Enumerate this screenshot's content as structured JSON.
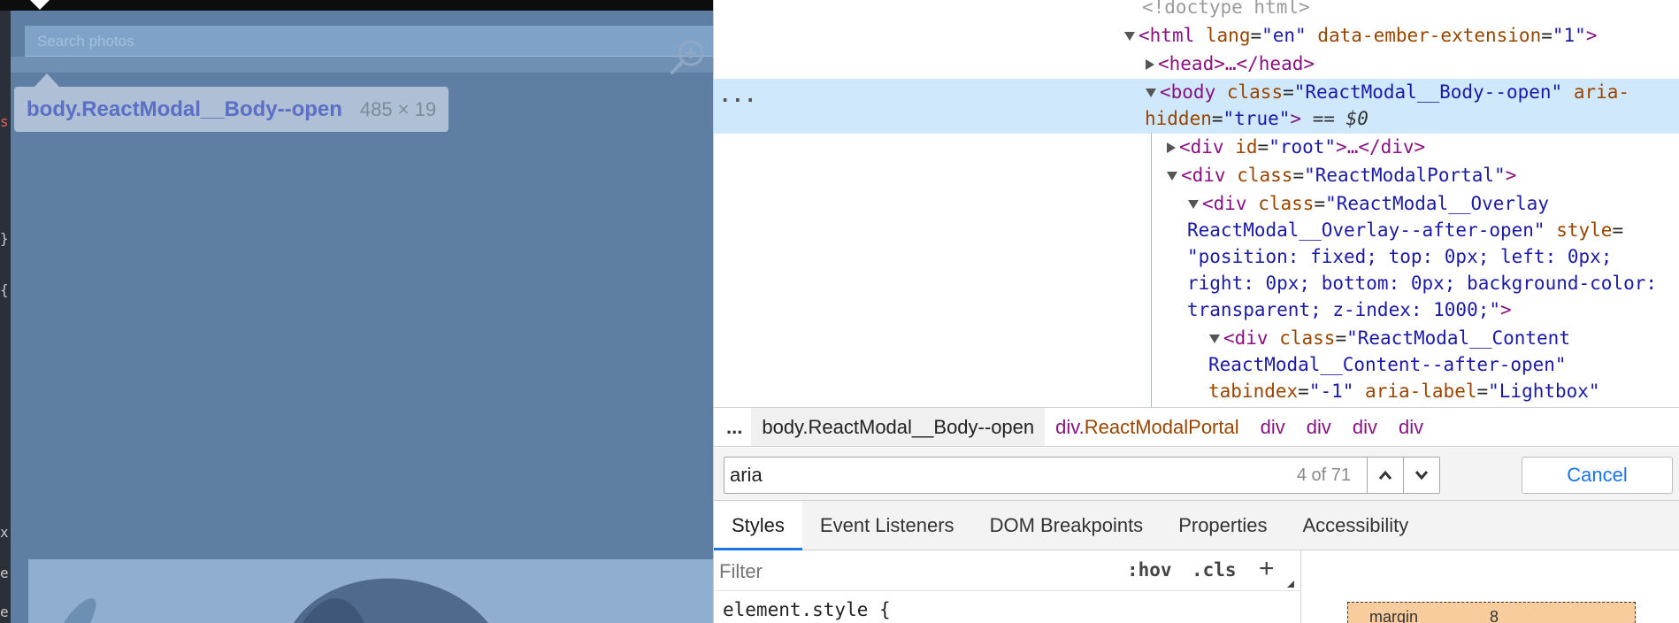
{
  "page": {
    "search_placeholder": "Search photos",
    "strip_chars": [
      "s",
      "}",
      "{",
      "x",
      "e",
      "e"
    ],
    "tooltip": {
      "element_name": "body.ReactModal__Body--open",
      "size": "485 × 19"
    }
  },
  "dom_tree": {
    "doctype": "<!doctype html>",
    "html_tag": "html",
    "html_lang_attr": "lang",
    "html_lang_val": "\"en\"",
    "html_ext_attr": "data-ember-extension",
    "html_ext_val": "\"1\"",
    "head_text": "<head>…</head>",
    "ellipsis": "...",
    "body_tag": "<body",
    "body_class_attr": "class",
    "body_class_val": "\"ReactModal__Body--open\"",
    "body_aria_attr_1": "aria-",
    "body_aria_attr_2": "hidden",
    "body_aria_val": "\"true\"",
    "body_close": ">",
    "body_eq": "== $0",
    "root_tag": "<div",
    "root_attr": "id",
    "root_val": "\"root\"",
    "root_tail": ">…</div>",
    "portal_tag": "<div",
    "portal_attr": "class",
    "portal_val": "\"ReactModalPortal\"",
    "portal_close": ">",
    "overlay_tag": "<div",
    "overlay_attr": "class",
    "overlay_val_1": "\"ReactModal__Overlay",
    "overlay_val_2": "ReactModal__Overlay--after-open\"",
    "overlay_style_attr": "style",
    "overlay_style_1": "\"position: fixed; top: 0px; left: 0px;",
    "overlay_style_2": "right: 0px; bottom: 0px; background-color:",
    "overlay_style_3": "transparent; z-index: 1000;\"",
    "overlay_close": ">",
    "content_tag": "<div",
    "content_attr": "class",
    "content_val_1": "\"ReactModal__Content",
    "content_val_2": "ReactModal__Content--after-open\"",
    "content_tabindex_attr": "tabindex",
    "content_tabindex_val": "\"-1\"",
    "content_aria_attr": "aria-label",
    "content_aria_val": "\"Lightbox\""
  },
  "breadcrumbs": {
    "ellipsis": "...",
    "items": [
      "body.ReactModal__Body--open",
      "div.",
      "ReactModalPortal",
      "div",
      "div",
      "div",
      "div"
    ]
  },
  "find": {
    "value": "aria",
    "count": "4 of 71",
    "cancel_label": "Cancel"
  },
  "tabs": [
    "Styles",
    "Event Listeners",
    "DOM Breakpoints",
    "Properties",
    "Accessibility"
  ],
  "styles": {
    "filter_placeholder": "Filter",
    "hov": ":hov",
    "cls": ".cls",
    "add": "+",
    "element_style": "element.style {"
  },
  "box_model": {
    "margin_label": "margin",
    "margin_value": "8"
  },
  "colors": {
    "highlight_overlay": "#5e7fa3",
    "selected_row": "#cfe8fc",
    "tag": "#881280",
    "attr_name": "#994500",
    "attr_value": "#1a1aa6",
    "accent": "#1a73e8",
    "margin": "#f9cc9d"
  }
}
